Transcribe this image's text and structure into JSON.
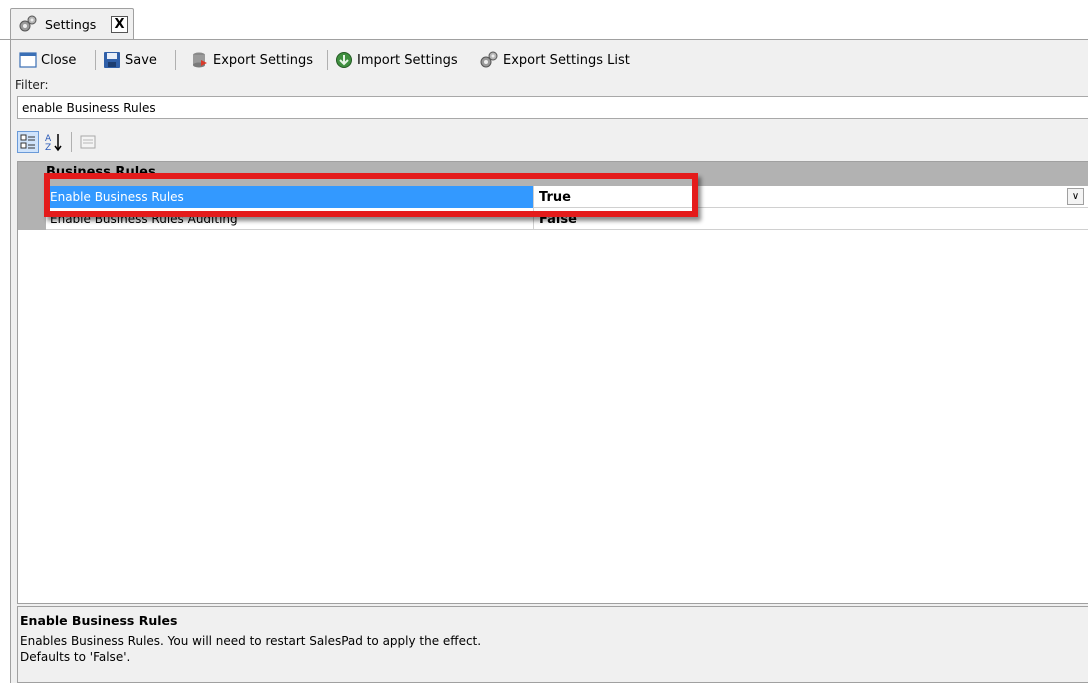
{
  "tab": {
    "label": "Settings",
    "close_label": "X"
  },
  "toolbar": {
    "close_label": "Close",
    "save_label": "Save",
    "export_settings_label": "Export Settings",
    "import_settings_label": "Import Settings",
    "export_settings_list_label": "Export Settings List"
  },
  "filter": {
    "label": "Filter:",
    "value": "enable Business Rules"
  },
  "grid_toolbar": {
    "categorized_active": true
  },
  "property_grid": {
    "category": "Business Rules",
    "rows": [
      {
        "name": "Enable Business Rules",
        "value": "True",
        "selected": true
      },
      {
        "name": "Enable Business Rules Auditing",
        "value": "False",
        "selected": false
      }
    ]
  },
  "help": {
    "title": "Enable Business Rules",
    "line1": "Enables Business Rules. You will need to restart SalesPad to apply the effect.",
    "line2": "Defaults to 'False'."
  },
  "colors": {
    "selection": "#3399ff",
    "highlight": "#e41b1b",
    "category_bg": "#b2b2b2"
  }
}
